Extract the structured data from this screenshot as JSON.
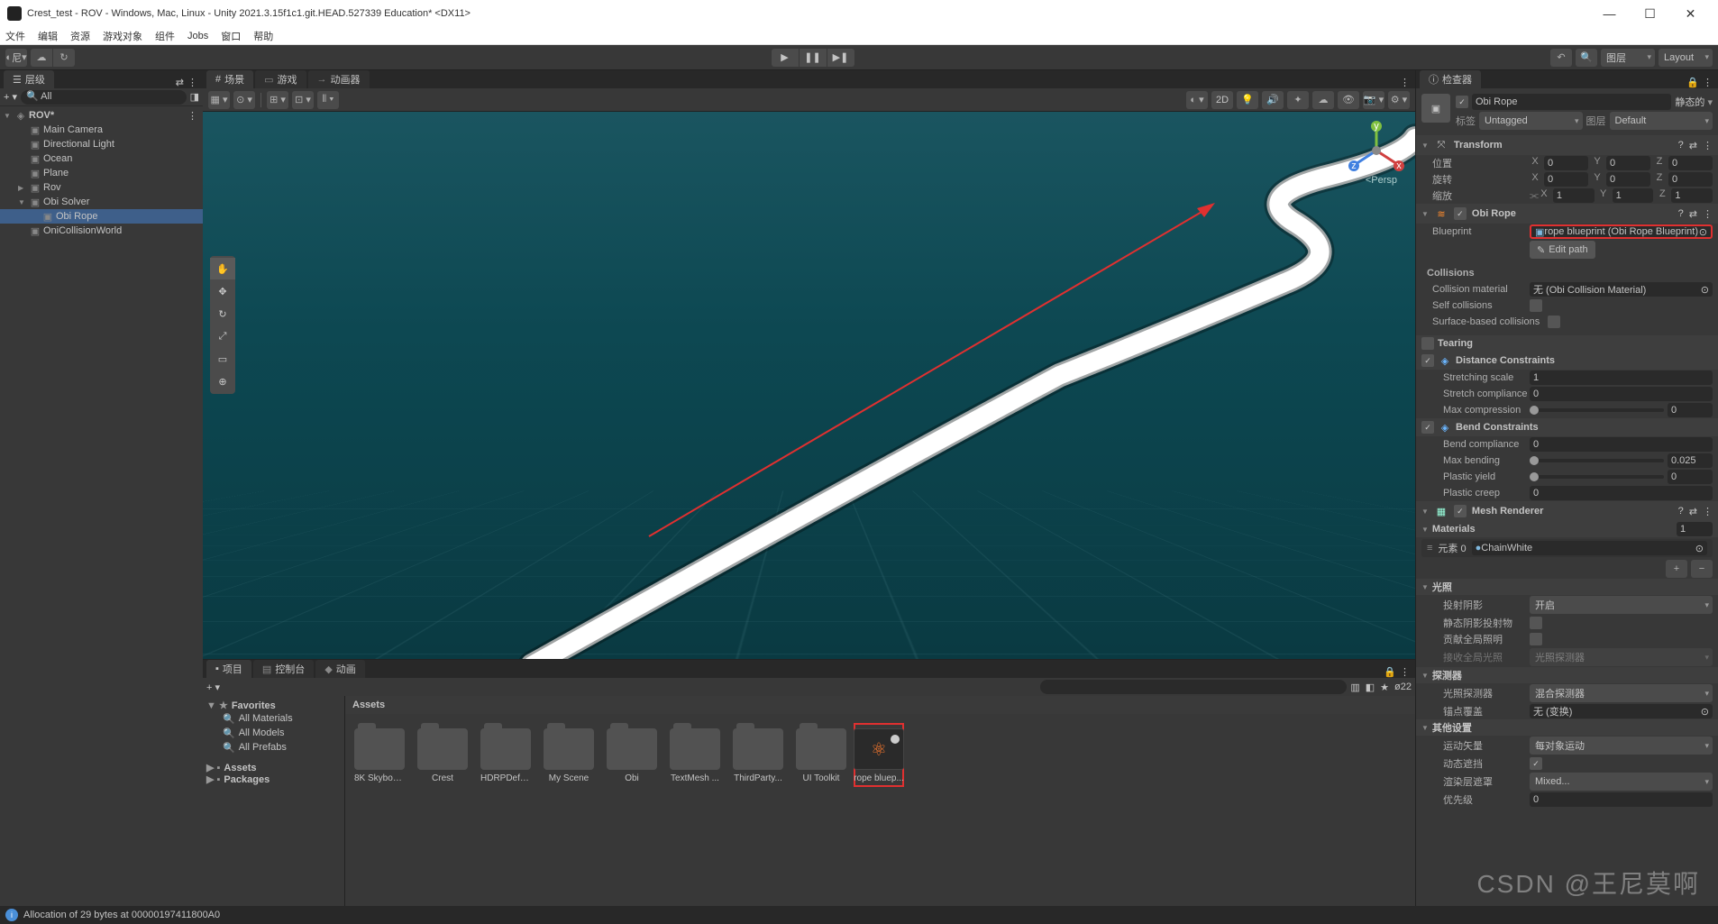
{
  "title": "Crest_test - ROV - Windows, Mac, Linux - Unity 2021.3.15f1c1.git.HEAD.527339 Education* <DX11>",
  "menu": [
    "文件",
    "编辑",
    "资源",
    "游戏对象",
    "组件",
    "Jobs",
    "窗口",
    "帮助"
  ],
  "toolbar": {
    "account": "尼",
    "layers": "图层",
    "layout": "Layout"
  },
  "hierarchy": {
    "tab": "层级",
    "searchPlaceholder": "All",
    "scene": "ROV*",
    "items": [
      {
        "name": "Main Camera",
        "indent": 1
      },
      {
        "name": "Directional Light",
        "indent": 1
      },
      {
        "name": "Ocean",
        "indent": 1
      },
      {
        "name": "Plane",
        "indent": 1
      },
      {
        "name": "Rov",
        "indent": 1,
        "arrow": true
      },
      {
        "name": "Obi Solver",
        "indent": 1,
        "arrow": true,
        "open": true
      },
      {
        "name": "Obi Rope",
        "indent": 2,
        "selected": true
      },
      {
        "name": "OniCollisionWorld",
        "indent": 1
      }
    ]
  },
  "sceneTabs": [
    {
      "label": "场景",
      "icon": "#",
      "active": true
    },
    {
      "label": "游戏",
      "icon": "∞"
    },
    {
      "label": "动画器",
      "icon": "→"
    }
  ],
  "sceneToolbar": {
    "mode2d": "2D",
    "persp": "<Persp"
  },
  "projectTabs": [
    {
      "label": "项目",
      "active": true
    },
    {
      "label": "控制台"
    },
    {
      "label": "动画"
    }
  ],
  "project": {
    "favorites": "Favorites",
    "favItems": [
      "All Materials",
      "All Models",
      "All Prefabs"
    ],
    "assets": "Assets",
    "packages": "Packages",
    "breadcrumb": "Assets",
    "hiddenCount": "22",
    "folders": [
      "8K Skybox ...",
      "Crest",
      "HDRPDefa...",
      "My Scene",
      "Obi",
      "TextMesh ...",
      "ThirdParty...",
      "UI Toolkit"
    ],
    "blueprint": "rope bluep..."
  },
  "inspector": {
    "tab": "检查器",
    "objName": "Obi Rope",
    "static": "静态的",
    "tagLabel": "标签",
    "tag": "Untagged",
    "layerLabel": "图层",
    "layer": "Default",
    "transform": {
      "title": "Transform",
      "pos": "位置",
      "rot": "旋转",
      "scale": "缩放",
      "x": "X",
      "y": "Y",
      "z": "Z",
      "p": [
        "0",
        "0",
        "0"
      ],
      "r": [
        "0",
        "0",
        "0"
      ],
      "s": [
        "1",
        "1",
        "1"
      ]
    },
    "obiRope": {
      "title": "Obi Rope",
      "blueprintLabel": "Blueprint",
      "blueprintValue": "rope blueprint (Obi Rope Blueprint)",
      "editPath": "Edit path",
      "collisions": "Collisions",
      "collisionMaterial": "Collision material",
      "collisionMaterialValue": "无 (Obi Collision Material)",
      "selfCollisions": "Self collisions",
      "surfaceCollisions": "Surface-based collisions",
      "tearing": "Tearing",
      "distanceConstraints": "Distance Constraints",
      "stretchingScale": "Stretching scale",
      "stretchingScaleV": "1",
      "stretchCompliance": "Stretch compliance",
      "stretchComplianceV": "0",
      "maxCompression": "Max compression",
      "maxCompressionV": "0",
      "bendConstraints": "Bend Constraints",
      "bendCompliance": "Bend compliance",
      "bendComplianceV": "0",
      "maxBending": "Max bending",
      "maxBendingV": "0.025",
      "plasticYield": "Plastic yield",
      "plasticYieldV": "0",
      "plasticCreep": "Plastic creep",
      "plasticCreepV": "0"
    },
    "meshRenderer": {
      "title": "Mesh Renderer",
      "materials": "Materials",
      "count": "1",
      "element": "元素 0",
      "elementV": "ChainWhite",
      "lighting": "光照",
      "castShadows": "投射阴影",
      "castShadowsV": "开启",
      "staticShadow": "静态阴影投射物",
      "contributeGI": "贡献全局照明",
      "receiveGI": "接收全局光照",
      "receiveGIV": "光照探测器",
      "probes": "探测器",
      "lightProbes": "光照探测器",
      "lightProbesV": "混合探测器",
      "anchorOverride": "锚点覆盖",
      "anchorOverrideV": "无 (变换)",
      "additional": "其他设置",
      "motionVectors": "运动矢量",
      "motionVectorsV": "每对象运动",
      "dynamicOcclusion": "动态遮挡",
      "renderingLayer": "渲染层遮罩",
      "renderingLayerV": "Mixed...",
      "priority": "优先级",
      "priorityV": "0"
    }
  },
  "status": "Allocation of 29 bytes at 00000197411800A0",
  "watermark": "CSDN @王尼莫啊"
}
